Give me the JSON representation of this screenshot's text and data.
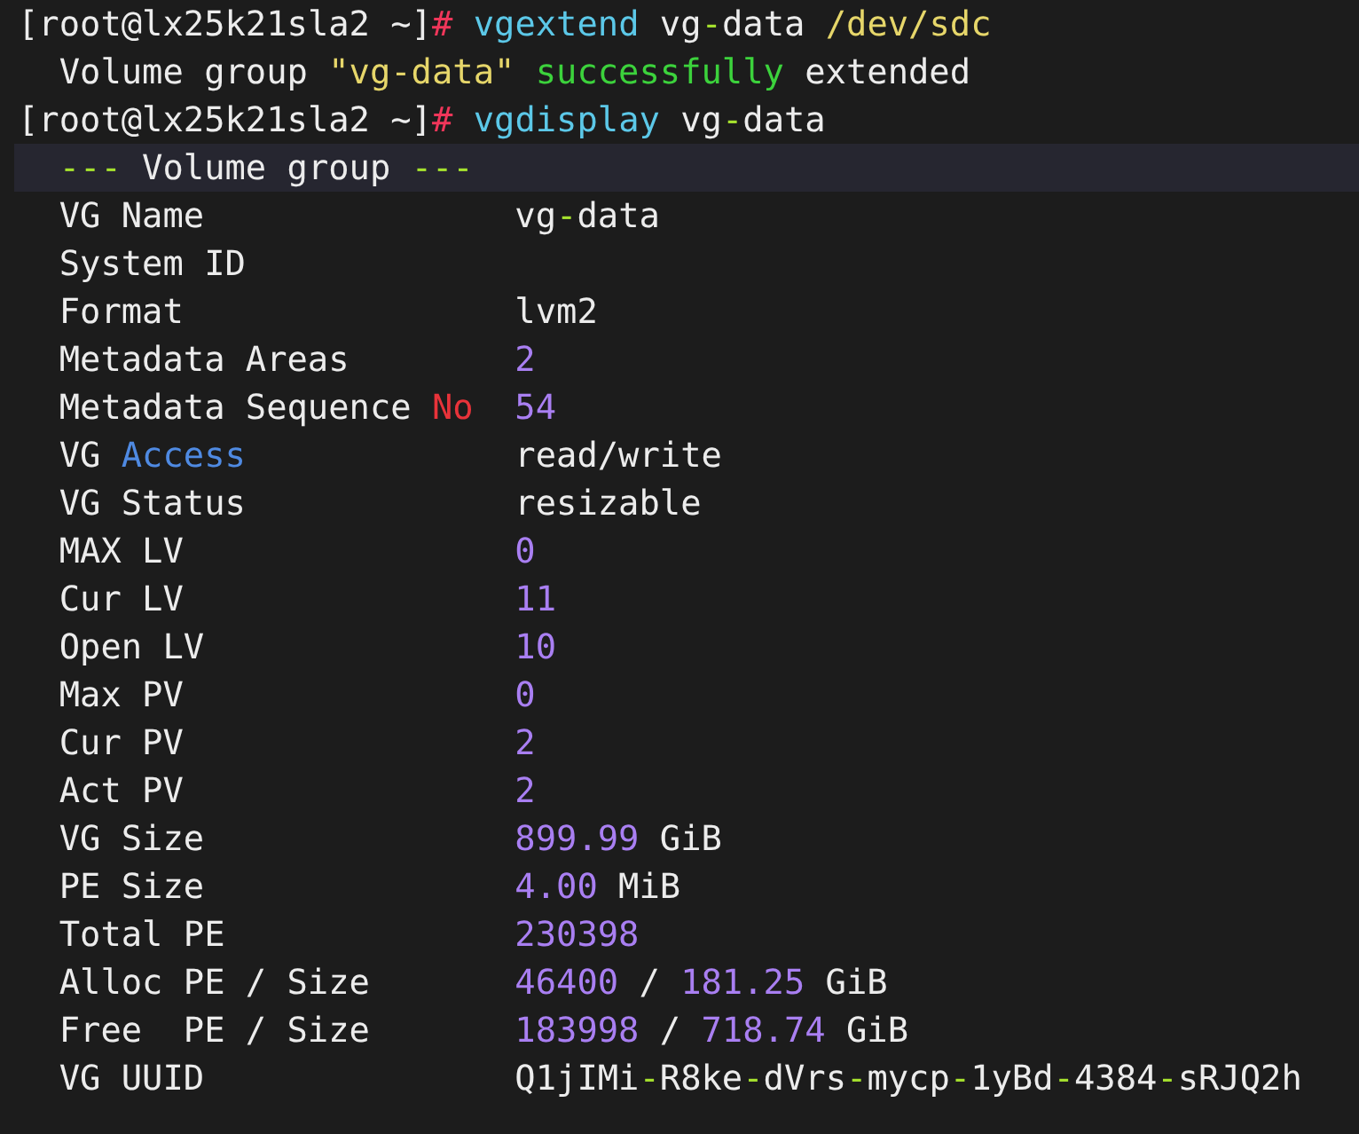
{
  "terminal": {
    "lines": [
      {
        "kind": "command",
        "highlighted": false,
        "segments": [
          {
            "text": "[root@lx25k21sla2 ~]",
            "kind": "plain"
          },
          {
            "text": "#",
            "kind": "hash"
          },
          {
            "text": " vgextend",
            "kind": "command"
          },
          {
            "text": " vg",
            "kind": "plain"
          },
          {
            "text": "-",
            "kind": "dash"
          },
          {
            "text": "data ",
            "kind": "plain"
          },
          {
            "text": "/dev/sdc",
            "kind": "path"
          }
        ]
      },
      {
        "kind": "output",
        "highlighted": false,
        "segments": [
          {
            "text": "Volume group ",
            "kind": "plain"
          },
          {
            "text": "\"vg-data\"",
            "kind": "string"
          },
          {
            "text": " successfully",
            "kind": "success"
          },
          {
            "text": " extended",
            "kind": "plain"
          }
        ]
      },
      {
        "kind": "command",
        "highlighted": false,
        "segments": [
          {
            "text": "[root@lx25k21sla2 ~]",
            "kind": "plain"
          },
          {
            "text": "#",
            "kind": "hash"
          },
          {
            "text": " vgdisplay",
            "kind": "command"
          },
          {
            "text": " vg",
            "kind": "plain"
          },
          {
            "text": "-",
            "kind": "dash"
          },
          {
            "text": "data",
            "kind": "plain"
          }
        ]
      },
      {
        "kind": "header",
        "highlighted": true,
        "segments": [
          {
            "text": "---",
            "kind": "dash"
          },
          {
            "text": " Volume group ",
            "kind": "plain"
          },
          {
            "text": "---",
            "kind": "dash"
          }
        ]
      },
      {
        "kind": "property",
        "highlighted": false,
        "label": [
          {
            "text": "VG Name",
            "kind": "plain"
          }
        ],
        "value": [
          {
            "text": "vg",
            "kind": "plain"
          },
          {
            "text": "-",
            "kind": "dash"
          },
          {
            "text": "data",
            "kind": "plain"
          }
        ]
      },
      {
        "kind": "property",
        "highlighted": false,
        "label": [
          {
            "text": "System ID",
            "kind": "plain"
          }
        ]
      },
      {
        "kind": "property",
        "highlighted": false,
        "label": [
          {
            "text": "Format",
            "kind": "plain"
          }
        ],
        "value": [
          {
            "text": "lvm2",
            "kind": "plain"
          }
        ]
      },
      {
        "kind": "property",
        "highlighted": false,
        "label": [
          {
            "text": "Metadata Areas",
            "kind": "plain"
          }
        ],
        "value": [
          {
            "text": "2",
            "kind": "number"
          }
        ]
      },
      {
        "kind": "property",
        "highlighted": false,
        "label": [
          {
            "text": "Metadata Sequence ",
            "kind": "plain"
          },
          {
            "text": "No",
            "kind": "keyword"
          }
        ],
        "value": [
          {
            "text": "54",
            "kind": "number"
          }
        ]
      },
      {
        "kind": "property",
        "highlighted": false,
        "label": [
          {
            "text": "VG ",
            "kind": "plain"
          },
          {
            "text": "Access",
            "kind": "link"
          }
        ],
        "value": [
          {
            "text": "read/write",
            "kind": "plain"
          }
        ]
      },
      {
        "kind": "property",
        "highlighted": false,
        "label": [
          {
            "text": "VG Status",
            "kind": "plain"
          }
        ],
        "value": [
          {
            "text": "resizable",
            "kind": "plain"
          }
        ]
      },
      {
        "kind": "property",
        "highlighted": false,
        "label": [
          {
            "text": "MAX LV",
            "kind": "plain"
          }
        ],
        "value": [
          {
            "text": "0",
            "kind": "number"
          }
        ]
      },
      {
        "kind": "property",
        "highlighted": false,
        "label": [
          {
            "text": "Cur LV",
            "kind": "plain"
          }
        ],
        "value": [
          {
            "text": "11",
            "kind": "number"
          }
        ]
      },
      {
        "kind": "property",
        "highlighted": false,
        "label": [
          {
            "text": "Open LV",
            "kind": "plain"
          }
        ],
        "value": [
          {
            "text": "10",
            "kind": "number"
          }
        ]
      },
      {
        "kind": "property",
        "highlighted": false,
        "label": [
          {
            "text": "Max PV",
            "kind": "plain"
          }
        ],
        "value": [
          {
            "text": "0",
            "kind": "number"
          }
        ]
      },
      {
        "kind": "property",
        "highlighted": false,
        "label": [
          {
            "text": "Cur PV",
            "kind": "plain"
          }
        ],
        "value": [
          {
            "text": "2",
            "kind": "number"
          }
        ]
      },
      {
        "kind": "property",
        "highlighted": false,
        "label": [
          {
            "text": "Act PV",
            "kind": "plain"
          }
        ],
        "value": [
          {
            "text": "2",
            "kind": "number"
          }
        ]
      },
      {
        "kind": "property",
        "highlighted": false,
        "label": [
          {
            "text": "VG Size",
            "kind": "plain"
          }
        ],
        "value": [
          {
            "text": "899.99",
            "kind": "number"
          },
          {
            "text": " GiB",
            "kind": "plain"
          }
        ]
      },
      {
        "kind": "property",
        "highlighted": false,
        "label": [
          {
            "text": "PE Size",
            "kind": "plain"
          }
        ],
        "value": [
          {
            "text": "4.00",
            "kind": "number"
          },
          {
            "text": " MiB",
            "kind": "plain"
          }
        ]
      },
      {
        "kind": "property",
        "highlighted": false,
        "label": [
          {
            "text": "Total PE",
            "kind": "plain"
          }
        ],
        "value": [
          {
            "text": "230398",
            "kind": "number"
          }
        ]
      },
      {
        "kind": "property",
        "highlighted": false,
        "label": [
          {
            "text": "Alloc PE / Size",
            "kind": "plain"
          }
        ],
        "value": [
          {
            "text": "46400",
            "kind": "number"
          },
          {
            "text": " / ",
            "kind": "plain"
          },
          {
            "text": "181.25",
            "kind": "number"
          },
          {
            "text": " GiB",
            "kind": "plain"
          }
        ]
      },
      {
        "kind": "property",
        "highlighted": false,
        "label": [
          {
            "text": "Free  PE / Size",
            "kind": "plain"
          }
        ],
        "value": [
          {
            "text": "183998",
            "kind": "number"
          },
          {
            "text": " / ",
            "kind": "plain"
          },
          {
            "text": "718.74",
            "kind": "number"
          },
          {
            "text": " GiB",
            "kind": "plain"
          }
        ]
      },
      {
        "kind": "property",
        "highlighted": false,
        "label": [
          {
            "text": "VG UUID",
            "kind": "plain"
          }
        ],
        "value": [
          {
            "text": "Q1jIMi",
            "kind": "plain"
          },
          {
            "text": "-",
            "kind": "dash"
          },
          {
            "text": "R8ke",
            "kind": "plain"
          },
          {
            "text": "-",
            "kind": "dash"
          },
          {
            "text": "dVrs",
            "kind": "plain"
          },
          {
            "text": "-",
            "kind": "dash"
          },
          {
            "text": "mycp",
            "kind": "plain"
          },
          {
            "text": "-",
            "kind": "dash"
          },
          {
            "text": "1yBd",
            "kind": "plain"
          },
          {
            "text": "-",
            "kind": "dash"
          },
          {
            "text": "4384",
            "kind": "plain"
          },
          {
            "text": "-",
            "kind": "dash"
          },
          {
            "text": "sRJQ2h",
            "kind": "plain"
          }
        ]
      }
    ]
  }
}
